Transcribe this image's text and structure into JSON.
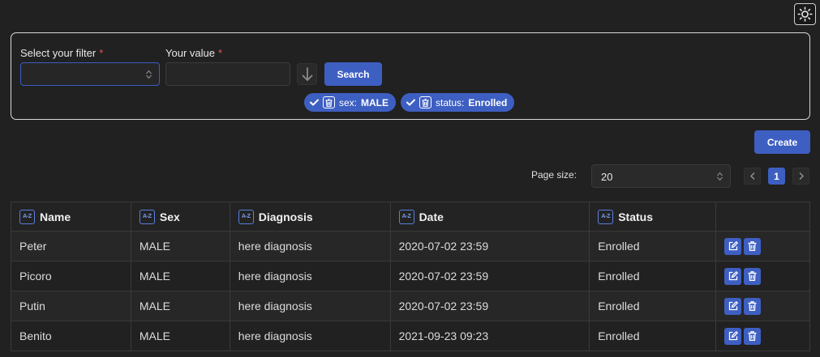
{
  "filter": {
    "filter_label": "Select your filter",
    "value_label": "Your value",
    "required_mark": "*",
    "filter_selected": "",
    "value_current": "",
    "search_label": "Search",
    "chips": [
      {
        "key": "sex:",
        "value": "MALE"
      },
      {
        "key": "status:",
        "value": "Enrolled"
      }
    ]
  },
  "toolbar": {
    "create_label": "Create"
  },
  "pagination": {
    "page_size_label": "Page size:",
    "page_size": "20",
    "current_page": "1"
  },
  "table": {
    "sort_icon_text": "A-Z",
    "columns": [
      "Name",
      "Sex",
      "Diagnosis",
      "Date",
      "Status"
    ],
    "rows": [
      {
        "name": "Peter",
        "sex": "MALE",
        "diagnosis": "here diagnosis",
        "date": "2020-07-02 23:59",
        "status": "Enrolled"
      },
      {
        "name": "Picoro",
        "sex": "MALE",
        "diagnosis": "here diagnosis",
        "date": "2020-07-02 23:59",
        "status": "Enrolled"
      },
      {
        "name": "Putin",
        "sex": "MALE",
        "diagnosis": "here diagnosis",
        "date": "2020-07-02 23:59",
        "status": "Enrolled"
      },
      {
        "name": "Benito",
        "sex": "MALE",
        "diagnosis": "here diagnosis",
        "date": "2021-09-23 09:23",
        "status": "Enrolled"
      }
    ]
  },
  "icons": {
    "theme": "sun-icon",
    "sort": "a-z-sort-icon",
    "edit": "edit-icon",
    "delete": "trash-icon",
    "check": "check-icon",
    "down": "arrow-down-icon"
  },
  "colors": {
    "background": "#212121",
    "accent": "#3e5fc2",
    "required": "#e0575b",
    "border": "#3a3a3a"
  }
}
